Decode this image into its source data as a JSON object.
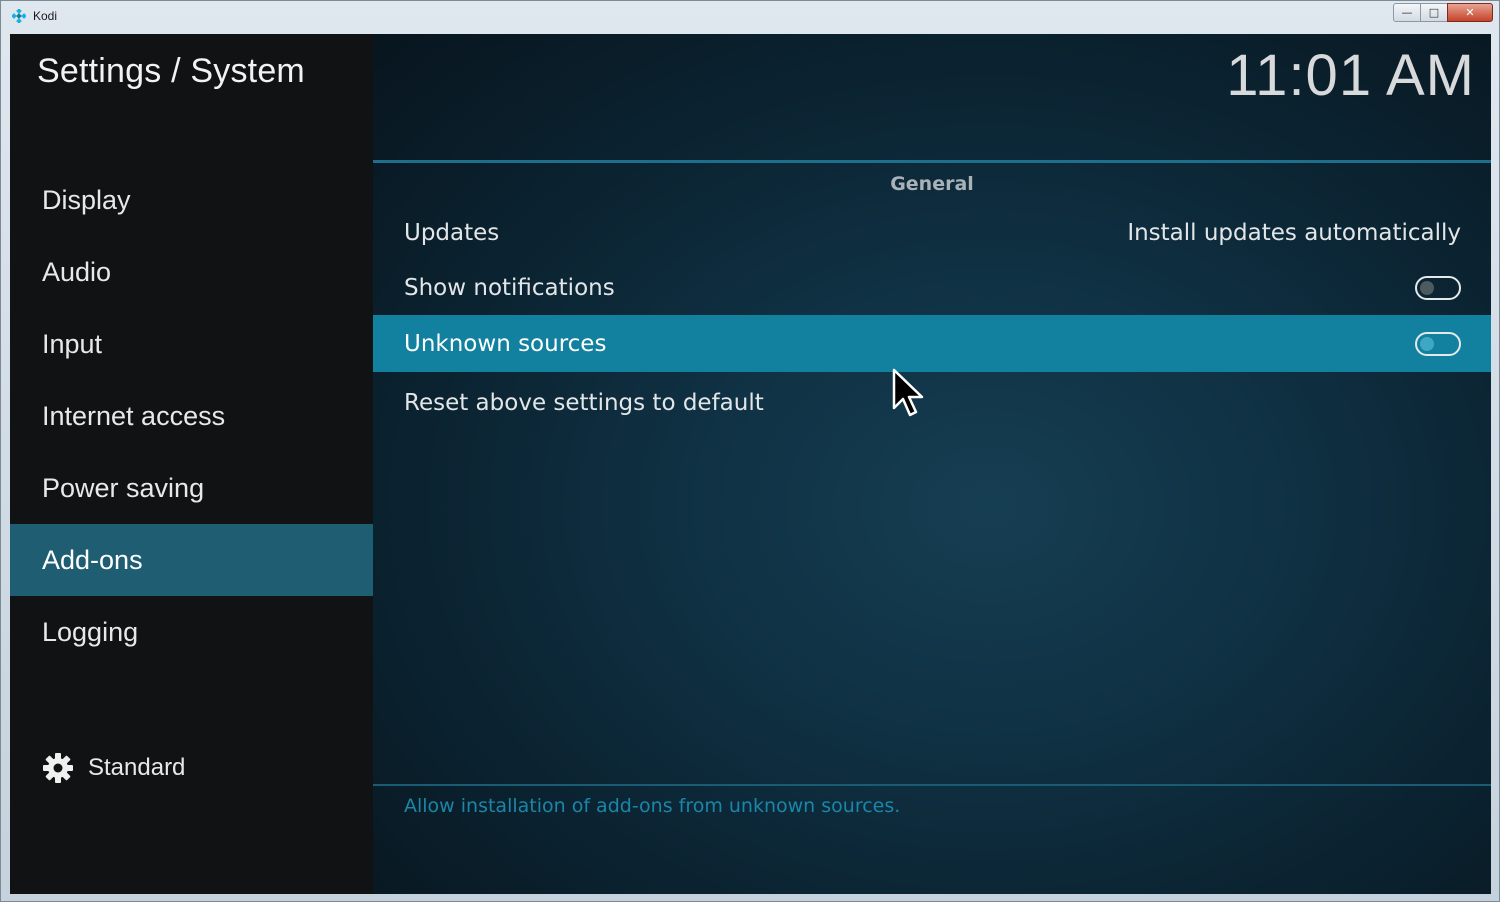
{
  "window": {
    "title": "Kodi",
    "controls": {
      "minimize": "—",
      "maximize": "□",
      "close": "✕"
    }
  },
  "sidebar": {
    "title": "Settings / System",
    "items": [
      {
        "label": "Display"
      },
      {
        "label": "Audio"
      },
      {
        "label": "Input"
      },
      {
        "label": "Internet access"
      },
      {
        "label": "Power saving"
      },
      {
        "label": "Add-ons",
        "active": true
      },
      {
        "label": "Logging"
      }
    ],
    "settings_level": {
      "icon": "gear-icon",
      "label": "Standard"
    }
  },
  "header": {
    "clock": "11:01 AM"
  },
  "main": {
    "section_title": "General",
    "settings": [
      {
        "label": "Updates",
        "value": "Install updates automatically"
      },
      {
        "label": "Show notifications",
        "toggle": false
      },
      {
        "label": "Unknown sources",
        "toggle": false,
        "focused": true
      },
      {
        "label": "Reset above settings to default"
      }
    ],
    "hint": "Allow installation of add-ons from unknown sources."
  },
  "colors": {
    "accent": "#12819f",
    "sidebar_active": "#1e5d72",
    "hint_text": "#1b86a9"
  }
}
